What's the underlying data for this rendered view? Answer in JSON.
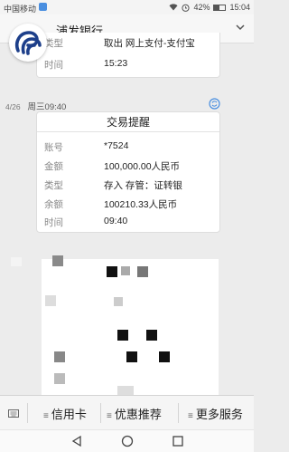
{
  "status_bar": {
    "carrier": "中国移动",
    "battery": "42%",
    "time": "15:04"
  },
  "header": {
    "title": "浦发银行"
  },
  "prev_message": {
    "rows": [
      {
        "label": "类型",
        "value": "取出 网上支付-支付宝"
      },
      {
        "label": "时间",
        "value": "15:23"
      }
    ]
  },
  "message": {
    "date": "4/26",
    "day_time": "周三09:40",
    "title": "交易提醒",
    "rows": [
      {
        "label": "账号",
        "value": "*7524"
      },
      {
        "label": "金额",
        "value": "100,000.00人民币"
      },
      {
        "label": "类型",
        "value": "存入 存管：证转银"
      },
      {
        "label": "余额",
        "value": "100210.33人民币"
      },
      {
        "label": "时间",
        "value": "09:40"
      }
    ]
  },
  "bottom_menu": {
    "items": [
      "信用卡",
      "优惠推荐",
      "更多服务"
    ]
  },
  "icons": {
    "keyboard": "keyboard-icon",
    "back": "back-icon",
    "home": "home-icon",
    "recents": "recents-icon",
    "refresh": "refresh-icon",
    "expand": "chevron-down-icon"
  },
  "colors": {
    "brand": "#1d3f8a",
    "accent": "#4a8fe0"
  }
}
